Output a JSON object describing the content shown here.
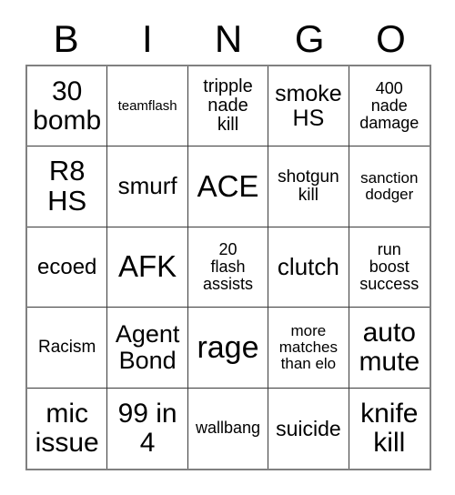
{
  "card": {
    "title": "BINGO",
    "header": {
      "letters": [
        "B",
        "I",
        "N",
        "G",
        "O"
      ]
    },
    "colors": {
      "background": "#ffffff",
      "text": "#000000",
      "outer_border": "#808080",
      "cell_border": "#3a3a3a"
    },
    "grid": {
      "rows": 5,
      "columns": 5,
      "cells": [
        {
          "text": "30\nbomb",
          "font_size": 30
        },
        {
          "text": "teamflash",
          "font_size": 15
        },
        {
          "text": "tripple\nnade\nkill",
          "font_size": 20
        },
        {
          "text": "smoke\nHS",
          "font_size": 25
        },
        {
          "text": "400\nnade\ndamage",
          "font_size": 18
        },
        {
          "text": "R8\nHS",
          "font_size": 31
        },
        {
          "text": "smurf",
          "font_size": 26
        },
        {
          "text": "ACE",
          "font_size": 33
        },
        {
          "text": "shotgun\nkill",
          "font_size": 19
        },
        {
          "text": "sanction\ndodger",
          "font_size": 17
        },
        {
          "text": "ecoed",
          "font_size": 24
        },
        {
          "text": "AFK",
          "font_size": 33
        },
        {
          "text": "20\nflash\nassists",
          "font_size": 18
        },
        {
          "text": "clutch",
          "font_size": 26
        },
        {
          "text": "run\nboost\nsuccess",
          "font_size": 18
        },
        {
          "text": "Racism",
          "font_size": 19
        },
        {
          "text": "Agent\nBond",
          "font_size": 27
        },
        {
          "text": "rage",
          "font_size": 34
        },
        {
          "text": "more\nmatches\nthan elo",
          "font_size": 17
        },
        {
          "text": "auto\nmute",
          "font_size": 30
        },
        {
          "text": "mic\nissue",
          "font_size": 30
        },
        {
          "text": "99 in\n4",
          "font_size": 30
        },
        {
          "text": "wallbang",
          "font_size": 18
        },
        {
          "text": "suicide",
          "font_size": 23
        },
        {
          "text": "knife\nkill",
          "font_size": 30
        }
      ]
    }
  }
}
